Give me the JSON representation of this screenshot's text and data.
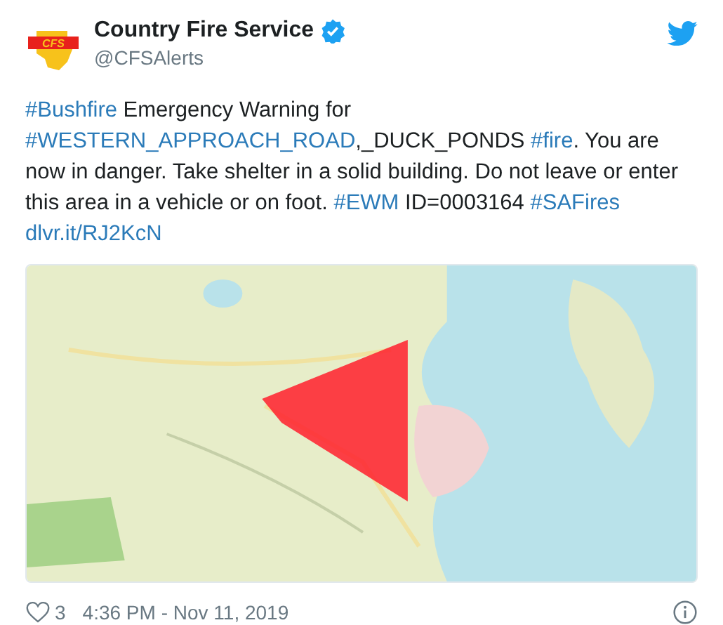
{
  "account": {
    "logo_text": "CFS",
    "name": "Country Fire Service",
    "verified": true,
    "handle": "@CFSAlerts"
  },
  "body": [
    {
      "kind": "hashtag",
      "text": "#Bushfire"
    },
    {
      "kind": "text",
      "text": " Emergency Warning for "
    },
    {
      "kind": "hashtag",
      "text": "#WESTERN_APPROACH_ROAD"
    },
    {
      "kind": "text",
      "text": ",_DUCK_PONDS "
    },
    {
      "kind": "hashtag",
      "text": "#fire"
    },
    {
      "kind": "text",
      "text": ". You are now in danger. Take shelter in a solid building. Do not leave or enter this area in a vehicle or on foot. "
    },
    {
      "kind": "hashtag",
      "text": "#EWM"
    },
    {
      "kind": "text",
      "text": " ID=0003164 "
    },
    {
      "kind": "hashtag",
      "text": "#SAFires"
    },
    {
      "kind": "link",
      "text": "dlvr.it/RJ2KcN"
    }
  ],
  "footer": {
    "likes": "3",
    "timestamp": "4:36 PM - Nov 11, 2019"
  }
}
